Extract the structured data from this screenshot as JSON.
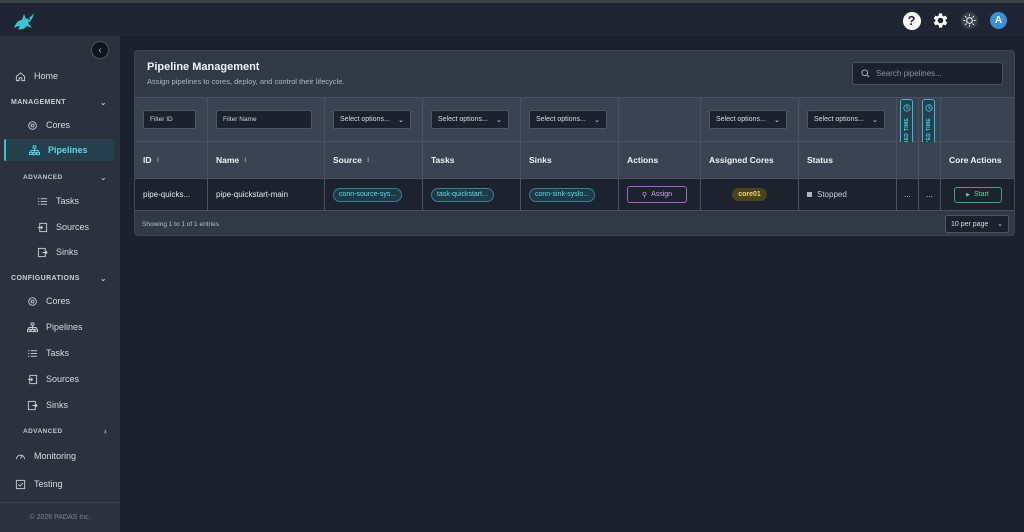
{
  "sidebar": {
    "home": "Home",
    "management": "MANAGEMENT",
    "cores": "Cores",
    "pipelines": "Pipelines",
    "advanced": "ADVANCED",
    "tasks": "Tasks",
    "sources": "Sources",
    "sinks": "Sinks",
    "configurations": "CONFIGURATIONS",
    "cfg_cores": "Cores",
    "cfg_pipelines": "Pipelines",
    "cfg_tasks": "Tasks",
    "cfg_sources": "Sources",
    "cfg_sinks": "Sinks",
    "cfg_advanced": "ADVANCED",
    "monitoring": "Monitoring",
    "testing": "Testing",
    "footer": "© 2026 PADAS Inc."
  },
  "topbar": {
    "help": "?",
    "avatar": "A"
  },
  "page": {
    "title": "Pipeline Management",
    "subtitle": "Assign pipelines to cores, deploy, and control their lifecycle.",
    "search_placeholder": "Search pipelines..."
  },
  "filters": {
    "id": "Filter ID",
    "name": "Filter Name",
    "source": "Select options...",
    "tasks": "Select options...",
    "sinks": "Select options...",
    "cores": "Select options...",
    "status": "Select options...",
    "assigned_time": "ASSIGNED TIME",
    "deployed_time": "DEPLOYED TIME"
  },
  "columns": {
    "id": "ID",
    "name": "Name",
    "source": "Source",
    "tasks": "Tasks",
    "sinks": "Sinks",
    "actions": "Actions",
    "assigned_cores": "Assigned Cores",
    "status": "Status",
    "core_actions": "Core Actions"
  },
  "rows": [
    {
      "id": "pipe-quicks...",
      "name": "pipe-quickstart-main",
      "source": "conn-source-sys...",
      "tasks": "task-quickstart...",
      "sinks": "conn-sink-syslo...",
      "action": "Assign",
      "core": "core01",
      "status": "Stopped",
      "assigned_time": "...",
      "deployed_time": "...",
      "core_action": "Start"
    }
  ],
  "footer": {
    "showing": "Showing 1 to 1 of 1 entries",
    "per_page": "10 per page"
  }
}
